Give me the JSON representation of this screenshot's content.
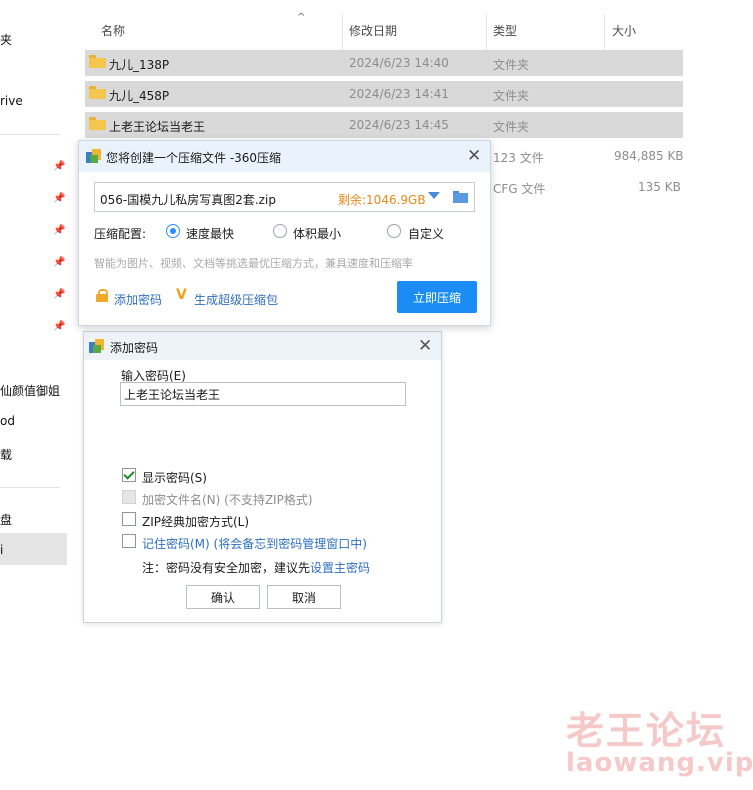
{
  "nav": {
    "items": [
      "夹",
      "rive",
      "仙颜值御姐",
      "od",
      "载",
      "盘"
    ],
    "selected_label": "i"
  },
  "file_list": {
    "columns": [
      "名称",
      "修改日期",
      "类型",
      "大小"
    ],
    "rows": [
      {
        "name": "九儿_138P",
        "date": "2024/6/23 14:40",
        "type": "文件夹",
        "size": ""
      },
      {
        "name": "九儿_458P",
        "date": "2024/6/23 14:41",
        "type": "文件夹",
        "size": ""
      },
      {
        "name": "上老王论坛当老王",
        "date": "2024/6/23 14:45",
        "type": "文件夹",
        "size": ""
      },
      {
        "name": "",
        "date": "",
        "type": "123 文件",
        "size": "984,885 KB"
      },
      {
        "name": "",
        "date": "",
        "type": "CFG 文件",
        "size": "135 KB"
      }
    ]
  },
  "compress_dialog": {
    "title": "您将创建一个压缩文件 -360压缩",
    "file_name": "056-国模九儿私房写真图2套.zip",
    "free_space": "剩余:1046.9GB",
    "config_label": "压缩配置:",
    "options": [
      "速度最快",
      "体积最小",
      "自定义"
    ],
    "selected_option": "速度最快",
    "hint": "智能为图片、视频、文档等挑选最优压缩方式，兼具速度和压缩率",
    "add_password": "添加密码",
    "super_compress": "生成超级压缩包",
    "compress_button": "立即压缩"
  },
  "password_dialog": {
    "title": "添加密码",
    "input_label": "输入密码(E)",
    "password_value": "上老王论坛当老王",
    "show_password": "显示密码(S)",
    "show_password_checked": true,
    "encrypt_names": "加密文件名(N) (不支持ZIP格式)",
    "zip_classic": "ZIP经典加密方式(L)",
    "remember": "记住密码(M) (将会备忘到密码管理窗口中)",
    "note_prefix": "注：密码没有安全加密，建议先",
    "note_link": "设置主密码",
    "ok": "确认",
    "cancel": "取消"
  },
  "watermark": {
    "line1": "老王论坛",
    "line2": "laowang.vip"
  },
  "colors": {
    "accent": "#1a8cf3",
    "selected_row": "#d9d9d9",
    "free_space": "#e7891b",
    "link": "#2f6fc0",
    "watermark": "#f6c9c9"
  }
}
